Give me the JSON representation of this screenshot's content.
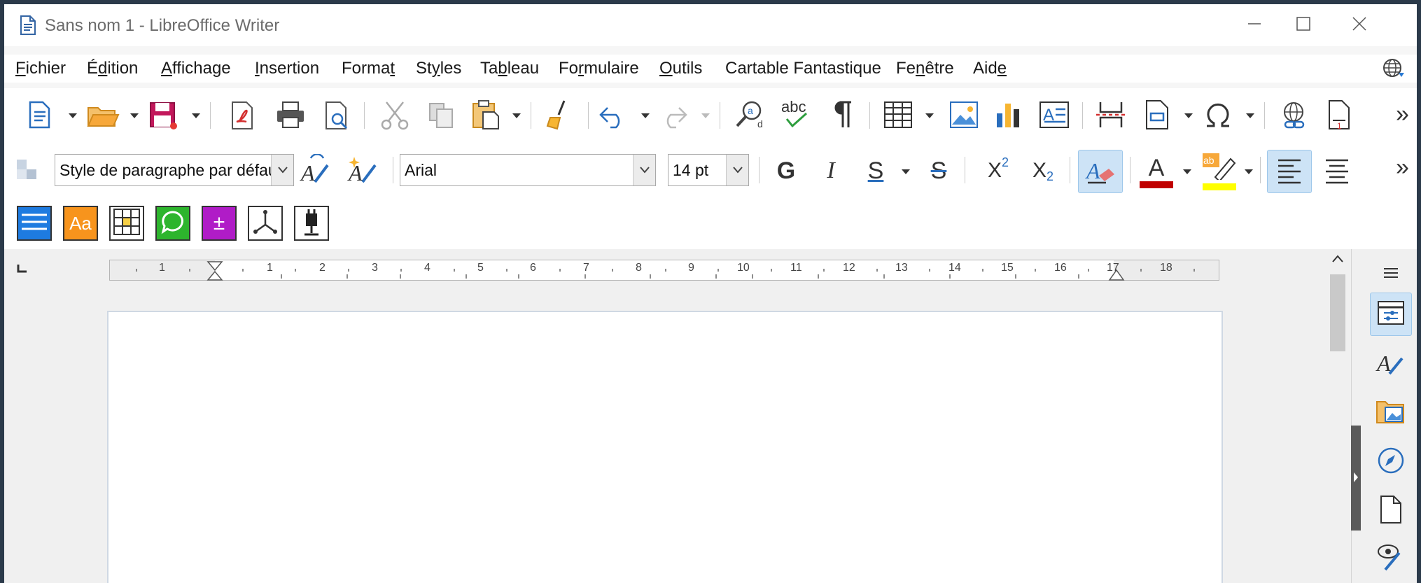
{
  "window": {
    "title": "Sans nom 1 - LibreOffice Writer",
    "controls": [
      "minimize",
      "maximize",
      "close"
    ]
  },
  "menubar": {
    "items": [
      {
        "pre": "",
        "key": "F",
        "post": "ichier"
      },
      {
        "pre": "É",
        "key": "d",
        "post": "ition"
      },
      {
        "pre": "",
        "key": "A",
        "post": "ffichage"
      },
      {
        "pre": "",
        "key": "I",
        "post": "nsertion"
      },
      {
        "pre": "Forma",
        "key": "t",
        "post": ""
      },
      {
        "pre": "St",
        "key": "y",
        "post": "les"
      },
      {
        "pre": "Ta",
        "key": "b",
        "post": "leau"
      },
      {
        "pre": "Fo",
        "key": "r",
        "post": "mulaire"
      },
      {
        "pre": "",
        "key": "O",
        "post": "utils"
      },
      {
        "pre": "Cartable Fantastique",
        "key": "",
        "post": ""
      },
      {
        "pre": "Fe",
        "key": "n",
        "post": "être"
      },
      {
        "pre": "Aid",
        "key": "e",
        "post": ""
      }
    ],
    "globe_icon": "language-globe-icon"
  },
  "toolbar_standard": {
    "icons": [
      "new-document-icon",
      "open-folder-icon",
      "save-icon",
      "export-pdf-icon",
      "print-icon",
      "print-preview-icon",
      "cut-icon",
      "copy-icon",
      "paste-icon",
      "clone-formatting-icon",
      "undo-icon",
      "redo-icon",
      "find-replace-icon",
      "spelling-icon",
      "formatting-marks-icon",
      "insert-table-icon",
      "insert-image-icon",
      "insert-chart-icon",
      "insert-textbox-icon",
      "page-break-icon",
      "insert-field-icon",
      "special-character-icon",
      "hyperlink-icon",
      "footnote-icon"
    ],
    "overflow": "»"
  },
  "toolbar_formatting": {
    "paragraph_style": "Style de paragraphe par défaut",
    "font_name": "Arial",
    "font_size": "14 pt",
    "bold": "G",
    "italic": "I",
    "underline": "S",
    "strikethrough": "S",
    "superscript_base": "X",
    "superscript_exp": "2",
    "subscript_base": "X",
    "subscript_exp": "2",
    "font_color_letter": "A",
    "highlight_text": "ab",
    "font_color": "#c00000",
    "highlight_color": "#ffff00",
    "overflow": "»"
  },
  "toolbar_cartable": {
    "icons": [
      {
        "name": "cartable-lines-icon",
        "color": "#1e7be0",
        "label": ""
      },
      {
        "name": "cartable-font-icon",
        "color": "#f7941d",
        "label": "Aa"
      },
      {
        "name": "cartable-table-icon",
        "color": "#ffffff",
        "label": ""
      },
      {
        "name": "cartable-speech-icon",
        "color": "#2db52d",
        "label": ""
      },
      {
        "name": "cartable-math-icon",
        "color": "#b01cc7",
        "label": "±"
      },
      {
        "name": "cartable-geometry-icon",
        "color": "#ffffff",
        "label": ""
      },
      {
        "name": "cartable-plugin-icon",
        "color": "#ffffff",
        "label": ""
      }
    ]
  },
  "ruler": {
    "unit": "cm",
    "left_labels": [
      "1"
    ],
    "labels": [
      "1",
      "2",
      "3",
      "4",
      "5",
      "6",
      "7",
      "8",
      "9",
      "10",
      "11",
      "12",
      "13",
      "14",
      "15",
      "16",
      "17",
      "18"
    ]
  },
  "sidebar": {
    "items": [
      "sidebar-menu-icon",
      "properties-icon",
      "styles-icon",
      "gallery-icon",
      "navigator-icon",
      "page-icon",
      "style-inspector-icon"
    ]
  }
}
